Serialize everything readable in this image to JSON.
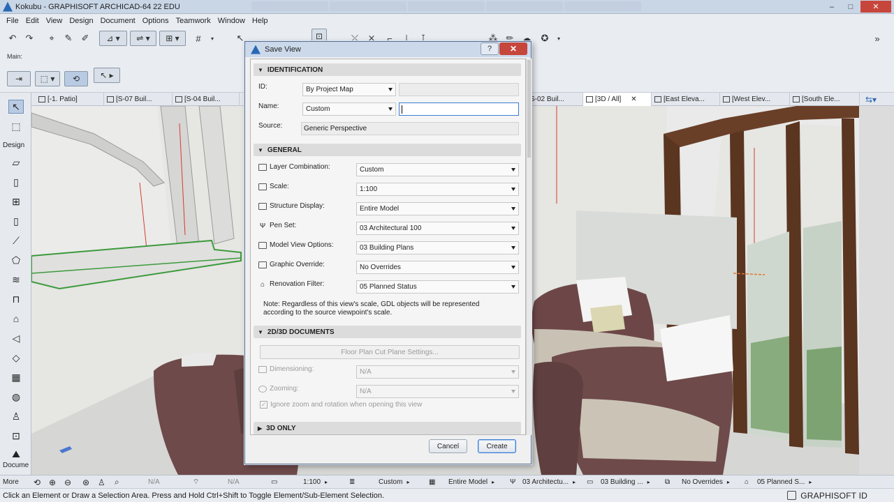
{
  "window": {
    "title": "Kokubu - GRAPHISOFT ARCHICAD-64 22 EDU",
    "buttons": [
      "–",
      "□",
      "✕"
    ]
  },
  "menubar": {
    "items": [
      "File",
      "Edit",
      "View",
      "Design",
      "Document",
      "Options",
      "Teamwork",
      "Window",
      "Help"
    ]
  },
  "toolbar": {
    "main_label": "Main:"
  },
  "view_tabs": [
    {
      "label": "[-1. Patio]"
    },
    {
      "label": "[S-07 Buil..."
    },
    {
      "label": "[S-04 Buil..."
    },
    {
      "label": "S-02 Buil..."
    },
    {
      "label": "[3D / All]",
      "close": "✕"
    },
    {
      "label": "[East Eleva..."
    },
    {
      "label": "[West Elev..."
    },
    {
      "label": "[South Ele..."
    }
  ],
  "toolbox": {
    "design_label": "Design",
    "document_label": "Docume",
    "more_label": "More"
  },
  "dialog": {
    "title": "Save View",
    "help": "?",
    "close": "✕",
    "identification": {
      "header": "IDENTIFICATION",
      "id_label": "ID:",
      "id_value": "By Project Map",
      "id_text": "",
      "name_label": "Name:",
      "name_value": "Custom",
      "name_text": "",
      "source_label": "Source:",
      "source_value": "Generic Perspective"
    },
    "general": {
      "header": "GENERAL",
      "rows": [
        {
          "label": "Layer Combination:",
          "value": "Custom"
        },
        {
          "label": "Scale:",
          "value": "1:100"
        },
        {
          "label": "Structure Display:",
          "value": "Entire Model"
        },
        {
          "label": "Pen Set:",
          "value": "03 Architectural 100"
        },
        {
          "label": "Model View Options:",
          "value": "03 Building Plans"
        },
        {
          "label": "Graphic Override:",
          "value": "No Overrides"
        },
        {
          "label": "Renovation Filter:",
          "value": "05 Planned Status"
        }
      ],
      "note_line1": "Note: Regardless of this view's scale, GDL objects will be represented",
      "note_line2": "according to the source viewpoint's scale."
    },
    "documents": {
      "header": "2D/3D DOCUMENTS",
      "floor_plan_button": "Floor Plan Cut Plane Settings...",
      "dimensioning_label": "Dimensioning:",
      "dimensioning_value": "N/A",
      "zooming_label": "Zooming:",
      "zooming_value": "N/A",
      "ignore_zoom_label": "Ignore zoom and rotation when opening this view",
      "ignore_zoom_check": "✓"
    },
    "only3d": {
      "header": "3D ONLY"
    },
    "cancel_label": "Cancel",
    "create_label": "Create"
  },
  "navbar": {
    "zoom_value": "N/A",
    "rotate_value": "N/A",
    "scale": "1:100",
    "layer": "Custom",
    "structure": "Entire Model",
    "pen": "03 Architectu...",
    "mvo": "03 Building ...",
    "override": "No Overrides",
    "renovation": "05 Planned S..."
  },
  "statusbar": {
    "message": "Click an Element or Draw a Selection Area. Press and Hold Ctrl+Shift to Toggle Element/Sub-Element Selection.",
    "brand": "GRAPHISOFT ID"
  },
  "colors": {
    "accent": "#3b7cd3",
    "close_red": "#c7463c",
    "wall_green": "#3c9a3c",
    "chair_brown": "#6e4a4a",
    "door_wood": "#5a3520"
  },
  "icons": [
    "undo-icon",
    "redo-icon",
    "arrow-cursor-icon",
    "marquee-icon",
    "wall-tool-icon",
    "column-tool-icon",
    "beam-tool-icon",
    "slab-tool-icon",
    "roof-tool-icon",
    "stair-tool-icon",
    "layer-icon",
    "scale-icon",
    "pen-icon"
  ]
}
